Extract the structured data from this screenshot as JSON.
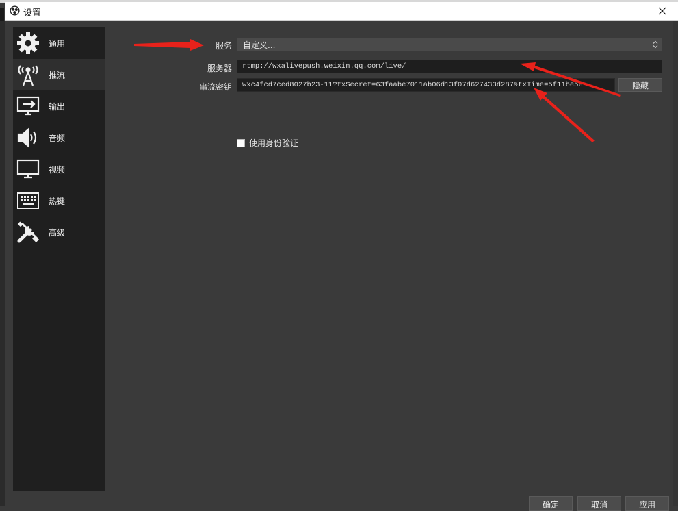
{
  "window": {
    "title": "设置",
    "close_icon": "close-icon"
  },
  "sidebar": {
    "items": [
      {
        "label": "通用",
        "icon": "gear-icon"
      },
      {
        "label": "推流",
        "icon": "antenna-icon"
      },
      {
        "label": "输出",
        "icon": "output-icon"
      },
      {
        "label": "音频",
        "icon": "speaker-icon"
      },
      {
        "label": "视频",
        "icon": "monitor-icon"
      },
      {
        "label": "热键",
        "icon": "keyboard-icon"
      },
      {
        "label": "高级",
        "icon": "tools-icon"
      }
    ],
    "active_index": 1
  },
  "stream": {
    "service_label": "服务",
    "service_value": "自定义...",
    "server_label": "服务器",
    "server_value": "rtmp://wxalivepush.weixin.qq.com/live/",
    "key_label": "串流密钥",
    "key_value": "wxc4fcd7ced8027b23-11?txSecret=63faabe7011ab06d13f07d627433d287&txTime=5f11be5e",
    "hide_button": "隐藏",
    "auth_label": "使用身份验证"
  },
  "footer": {
    "ok": "确定",
    "cancel": "取消",
    "apply": "应用"
  },
  "colors": {
    "annotation_arrow": "#e8221b",
    "panel": "#3a3a3a",
    "sidebar": "#1f1f1f"
  }
}
